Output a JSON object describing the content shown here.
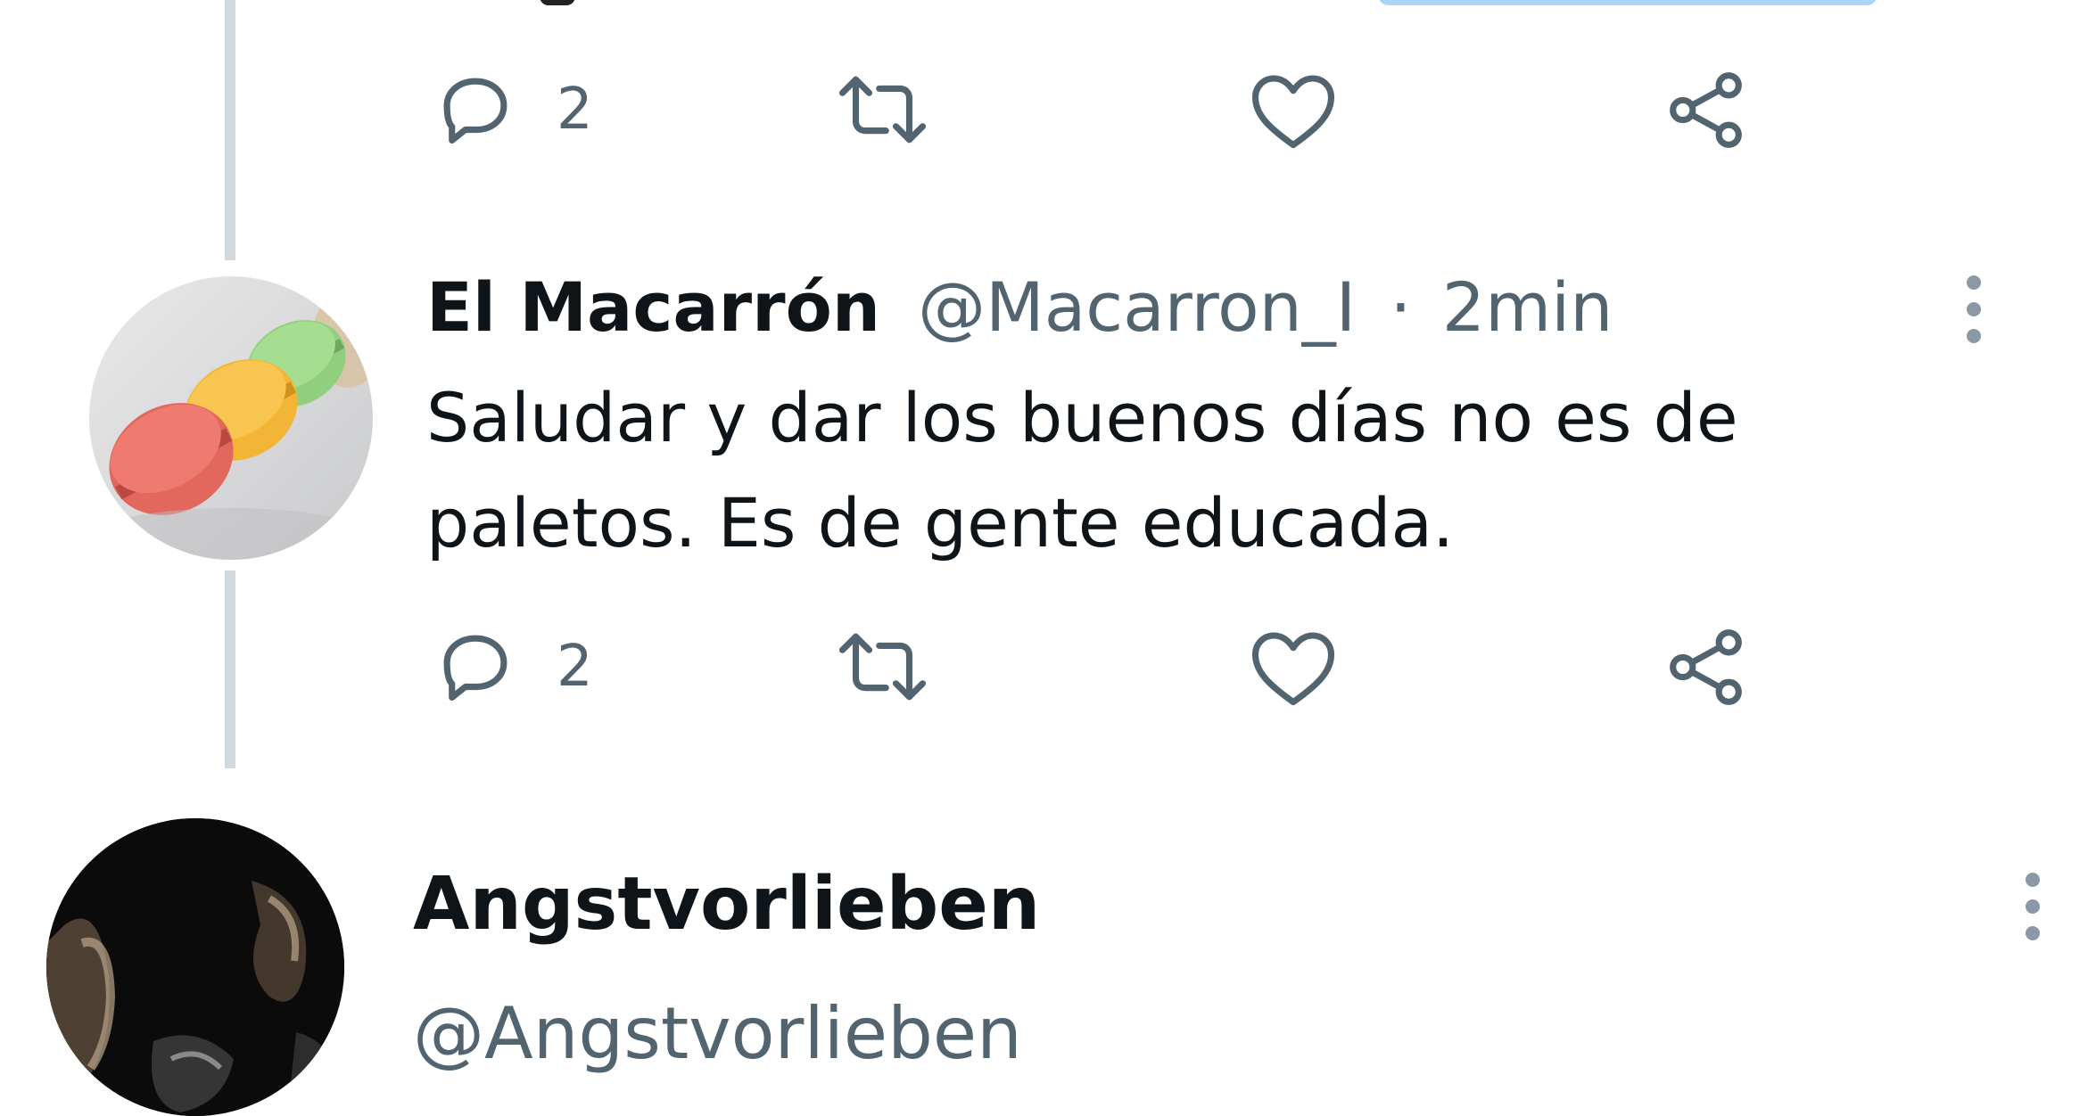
{
  "colors": {
    "text_primary": "#0f1419",
    "text_secondary": "#536471",
    "thread_line": "#cfd9de",
    "background": "#ffffff"
  },
  "previous_tweet": {
    "actions": {
      "reply_count": "2",
      "reply_icon": "reply-icon",
      "retweet_icon": "retweet-icon",
      "like_icon": "heart-icon",
      "share_icon": "share-icon"
    }
  },
  "tweet": {
    "display_name": "El Macarrón",
    "handle": "@Macarron_I",
    "separator": "·",
    "time": "2min",
    "text_line1": "Saludar y dar los buenos días no es de",
    "text_line2": "paletos. Es de gente educada.",
    "avatar_icon": "macaron-avatar",
    "more_icon": "more-vertical-icon",
    "actions": {
      "reply_count": "2",
      "reply_icon": "reply-icon",
      "retweet_icon": "retweet-icon",
      "like_icon": "heart-icon",
      "share_icon": "share-icon"
    }
  },
  "next_tweet": {
    "display_name": "Angstvorlieben",
    "handle": "@Angstvorlieben",
    "avatar_icon": "dark-photo-avatar",
    "more_icon": "more-vertical-icon"
  }
}
